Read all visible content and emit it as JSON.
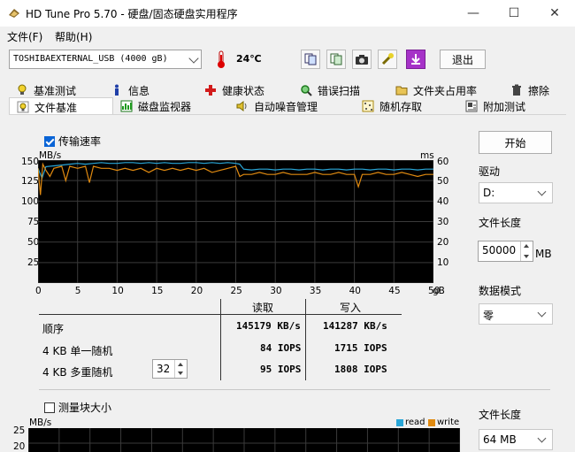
{
  "window": {
    "title": "HD Tune Pro 5.70 - 硬盘/固态硬盘实用程序",
    "minimize": "—",
    "maximize": "☐",
    "close": "✕"
  },
  "menu": [
    {
      "label": "文件(F)"
    },
    {
      "label": "帮助(H)"
    }
  ],
  "toolbar": {
    "drive": "TOSHIBAEXTERNAL_USB (4000 gB)",
    "temperature": "24℃",
    "exit_label": "退出"
  },
  "tabs_row1": [
    {
      "label": "基准测试",
      "icon": "bulb-icon"
    },
    {
      "label": "信息",
      "icon": "info-icon"
    },
    {
      "label": "健康状态",
      "icon": "health-cross-icon"
    },
    {
      "label": "错误扫描",
      "icon": "magnifier-icon"
    },
    {
      "label": "文件夹占用率",
      "icon": "folder-icon"
    },
    {
      "label": "擦除",
      "icon": "trash-icon"
    }
  ],
  "tabs_row2": [
    {
      "label": "文件基准",
      "icon": "bulb-page-icon",
      "active": true
    },
    {
      "label": "磁盘监视器",
      "icon": "monitor-chart-icon"
    },
    {
      "label": "自动噪音管理",
      "icon": "speaker-icon"
    },
    {
      "label": "随机存取",
      "icon": "random-grid-icon"
    },
    {
      "label": "附加测试",
      "icon": "extra-test-icon"
    }
  ],
  "transfer": {
    "checkbox_label": "传输速率",
    "checked": true
  },
  "chart_data": {
    "type": "line",
    "y_left_unit": "MB/s",
    "y_right_unit": "ms",
    "x_unit": "gB",
    "x_ticks": [
      "0",
      "5",
      "10",
      "15",
      "20",
      "25",
      "30",
      "35",
      "40",
      "45",
      "50"
    ],
    "y_left_ticks": [
      "150",
      "125",
      "100",
      "75",
      "50",
      "25"
    ],
    "y_right_ticks": [
      "60",
      "50",
      "40",
      "30",
      "20",
      "10"
    ],
    "xlim": [
      0,
      50
    ],
    "ylim_left": [
      0,
      150
    ],
    "ylim_right": [
      0,
      60
    ],
    "grid": true,
    "series": [
      {
        "color": "#2aa7d8",
        "x": [
          0,
          0.5,
          1,
          2,
          3,
          4,
          5,
          6,
          7,
          8,
          9,
          10,
          11,
          12,
          13,
          14,
          15,
          16,
          17,
          18,
          19,
          20,
          21,
          22,
          23,
          24,
          25,
          25.5,
          26,
          27,
          28,
          29,
          30,
          31,
          32,
          33,
          34,
          35,
          36,
          37,
          38,
          39,
          40,
          41,
          42,
          43,
          44,
          45,
          46,
          47,
          48,
          49,
          50
        ],
        "y": [
          140,
          128,
          142,
          143,
          144,
          145,
          146,
          145,
          146,
          147,
          146,
          146,
          147,
          147,
          146,
          147,
          146,
          147,
          146,
          146,
          147,
          147,
          146,
          147,
          146,
          147,
          146,
          145,
          139,
          138,
          139,
          139,
          138,
          139,
          139,
          138,
          139,
          139,
          138,
          139,
          139,
          138,
          139,
          139,
          138,
          139,
          139,
          138,
          139,
          139,
          138,
          139,
          139
        ]
      },
      {
        "color": "#e08a10",
        "x": [
          0,
          0.3,
          0.6,
          1,
          1.5,
          2,
          3,
          3.5,
          4,
          5,
          6,
          6.5,
          7,
          8,
          9,
          10,
          11,
          12,
          13,
          14,
          15,
          16,
          17,
          18,
          19,
          20,
          21,
          22,
          23,
          24,
          25,
          25.5,
          26,
          27,
          28,
          29,
          30,
          31,
          32,
          33,
          34,
          35,
          36,
          37,
          38,
          39,
          40,
          40.5,
          41,
          42,
          43,
          44,
          45,
          46,
          47,
          48,
          49,
          50
        ],
        "y": [
          56,
          43,
          58,
          55,
          52,
          56,
          57,
          50,
          57,
          56,
          57,
          49,
          57,
          56,
          56,
          55,
          56,
          55,
          56,
          54,
          56,
          55,
          56,
          55,
          56,
          55,
          56,
          54,
          55,
          56,
          57,
          52,
          53,
          53,
          54,
          53,
          53,
          54,
          53,
          53,
          53,
          54,
          53,
          53,
          54,
          53,
          53,
          47,
          53,
          53,
          54,
          53,
          53,
          54,
          53,
          52,
          53,
          53
        ]
      }
    ]
  },
  "results": {
    "col_read": "读取",
    "col_write": "写入",
    "rows": [
      {
        "label": "顺序",
        "read": "145179 KB/s",
        "write": "141287 KB/s"
      },
      {
        "label": "4 KB 单一随机",
        "read": "84 IOPS",
        "write": "1715 IOPS"
      },
      {
        "label": "4 KB 多重随机",
        "read": "95 IOPS",
        "write": "1808 IOPS"
      }
    ],
    "queue_depth": "32"
  },
  "right_panel": {
    "start_label": "开始",
    "drive_label": "驱动",
    "drive_value": "D:",
    "file_length_label": "文件长度",
    "file_length_value": "50000",
    "file_length_unit": "MB",
    "data_mode_label": "数据模式",
    "data_mode_value": "零"
  },
  "block": {
    "checkbox_label": "测量块大小",
    "checked": false,
    "y_unit": "MB/s",
    "y_ticks": [
      "25",
      "20"
    ],
    "legend_read": "read",
    "legend_write": "write",
    "file_length_label": "文件长度",
    "file_length_value": "64 MB"
  },
  "colors": {
    "read": "#2aa7d8",
    "write": "#e08a10",
    "accent": "#0a64d6"
  }
}
